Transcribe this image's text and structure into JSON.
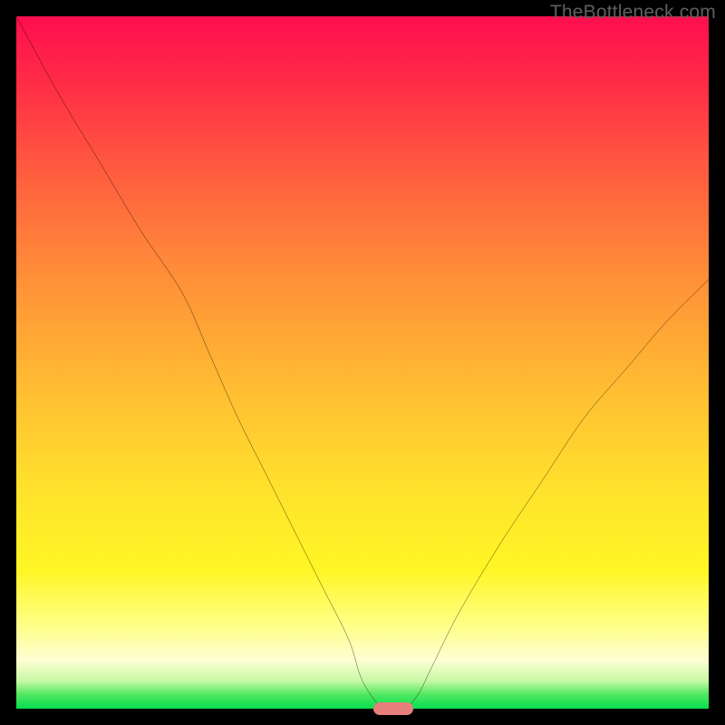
{
  "watermark": "TheBottleneck.com",
  "colors": {
    "frame": "#000000",
    "curve": "#000000",
    "marker": "#e77f7d",
    "gradient_stops": [
      "#ff0e4e",
      "#ff2d45",
      "#ff5b3f",
      "#ff8a39",
      "#ffb833",
      "#ffe12c",
      "#fff625",
      "#ffff88",
      "#fffed3",
      "#c6f9a4",
      "#4ee760",
      "#07df4f"
    ]
  },
  "chart_data": {
    "type": "line",
    "title": "",
    "xlabel": "",
    "ylabel": "",
    "xlim": [
      0,
      100
    ],
    "ylim": [
      0,
      100
    ],
    "grid": false,
    "series": [
      {
        "name": "bottleneck-curve",
        "x": [
          0,
          6,
          12,
          18,
          24,
          28,
          32,
          36,
          40,
          44,
          48,
          50,
          53,
          56,
          58,
          60,
          64,
          70,
          76,
          82,
          88,
          94,
          100
        ],
        "values": [
          100,
          89,
          79,
          69,
          60,
          51,
          42,
          34,
          26,
          18,
          10,
          4,
          0,
          0,
          2,
          6,
          14,
          24,
          33,
          42,
          49,
          56,
          62
        ]
      }
    ],
    "annotations": [
      {
        "name": "valley-marker",
        "x": 54.5,
        "y": 0,
        "shape": "capsule"
      }
    ]
  }
}
